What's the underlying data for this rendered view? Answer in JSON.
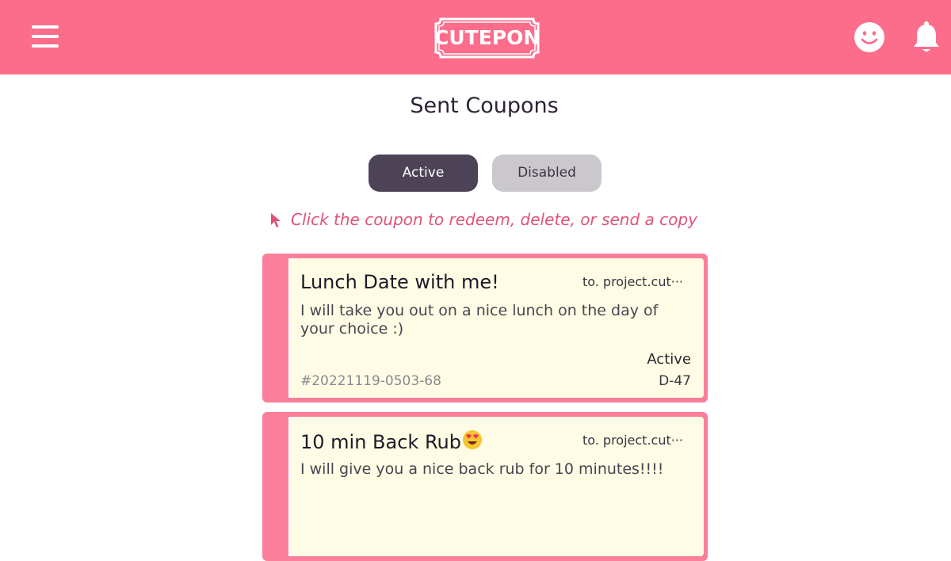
{
  "header": {
    "logo_text": "CUTEPON",
    "menu_icon": "hamburger-menu-icon",
    "profile_icon": "smiley-face-icon",
    "notification_icon": "bell-icon",
    "background_color": "#fb6d8a"
  },
  "page": {
    "title": "Sent Coupons",
    "hint": "Click the coupon to redeem, delete, or send a copy",
    "hint_icon": "cursor-pointer-icon"
  },
  "tabs": [
    {
      "label": "Active",
      "selected": true
    },
    {
      "label": "Disabled",
      "selected": false
    }
  ],
  "coupons": [
    {
      "title": "Lunch Date with me!",
      "to": "to. project.cut···",
      "description": "I will take you out on a nice lunch on the day of your choice :)",
      "status": "Active",
      "id": "#20221119-0503-68",
      "days_left": "D-47"
    },
    {
      "title": "10 min Back Rub",
      "title_emoji": "heart-eyes-emoji-icon",
      "to": "to. project.cut···",
      "description": "I will give you a nice back rub for 10 minutes!!!!"
    }
  ],
  "colors": {
    "accent": "#fb6d8a",
    "coupon_border": "#fb7f9a",
    "coupon_bg": "#fefce4",
    "active_tab": "#4d4356",
    "inactive_tab": "#cac8cd",
    "hint_text": "#e0537a"
  }
}
